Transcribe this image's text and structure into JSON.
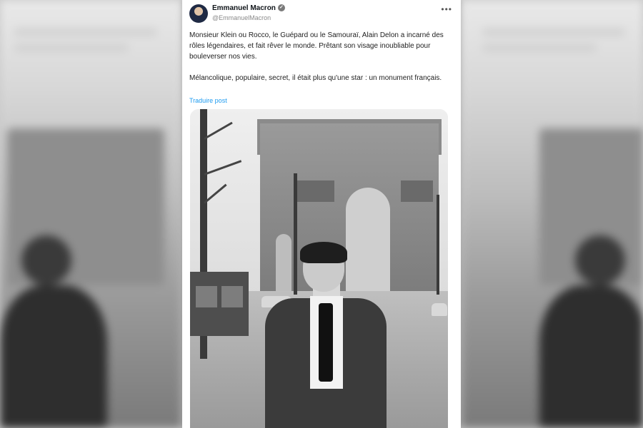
{
  "tweet": {
    "author_name": "Emmanuel Macron",
    "author_handle": "@EmmanuelMacron",
    "more_icon": "more-horizontal-icon",
    "verified_icon": "verified-badge-icon",
    "paragraph_1": "Monsieur Klein ou Rocco, le Guépard ou le Samouraï, Alain Delon a incarné des rôles légendaires, et fait rêver le monde. Prêtant son visage inoubliable pour bouleverser nos vies.",
    "paragraph_2": "Mélancolique, populaire, secret, il était plus qu'une star : un monument français.",
    "translate_label": "Traduire post"
  },
  "colors": {
    "link": "#1d9bf0",
    "text": "#222222",
    "secondary": "#8a8a8a"
  }
}
